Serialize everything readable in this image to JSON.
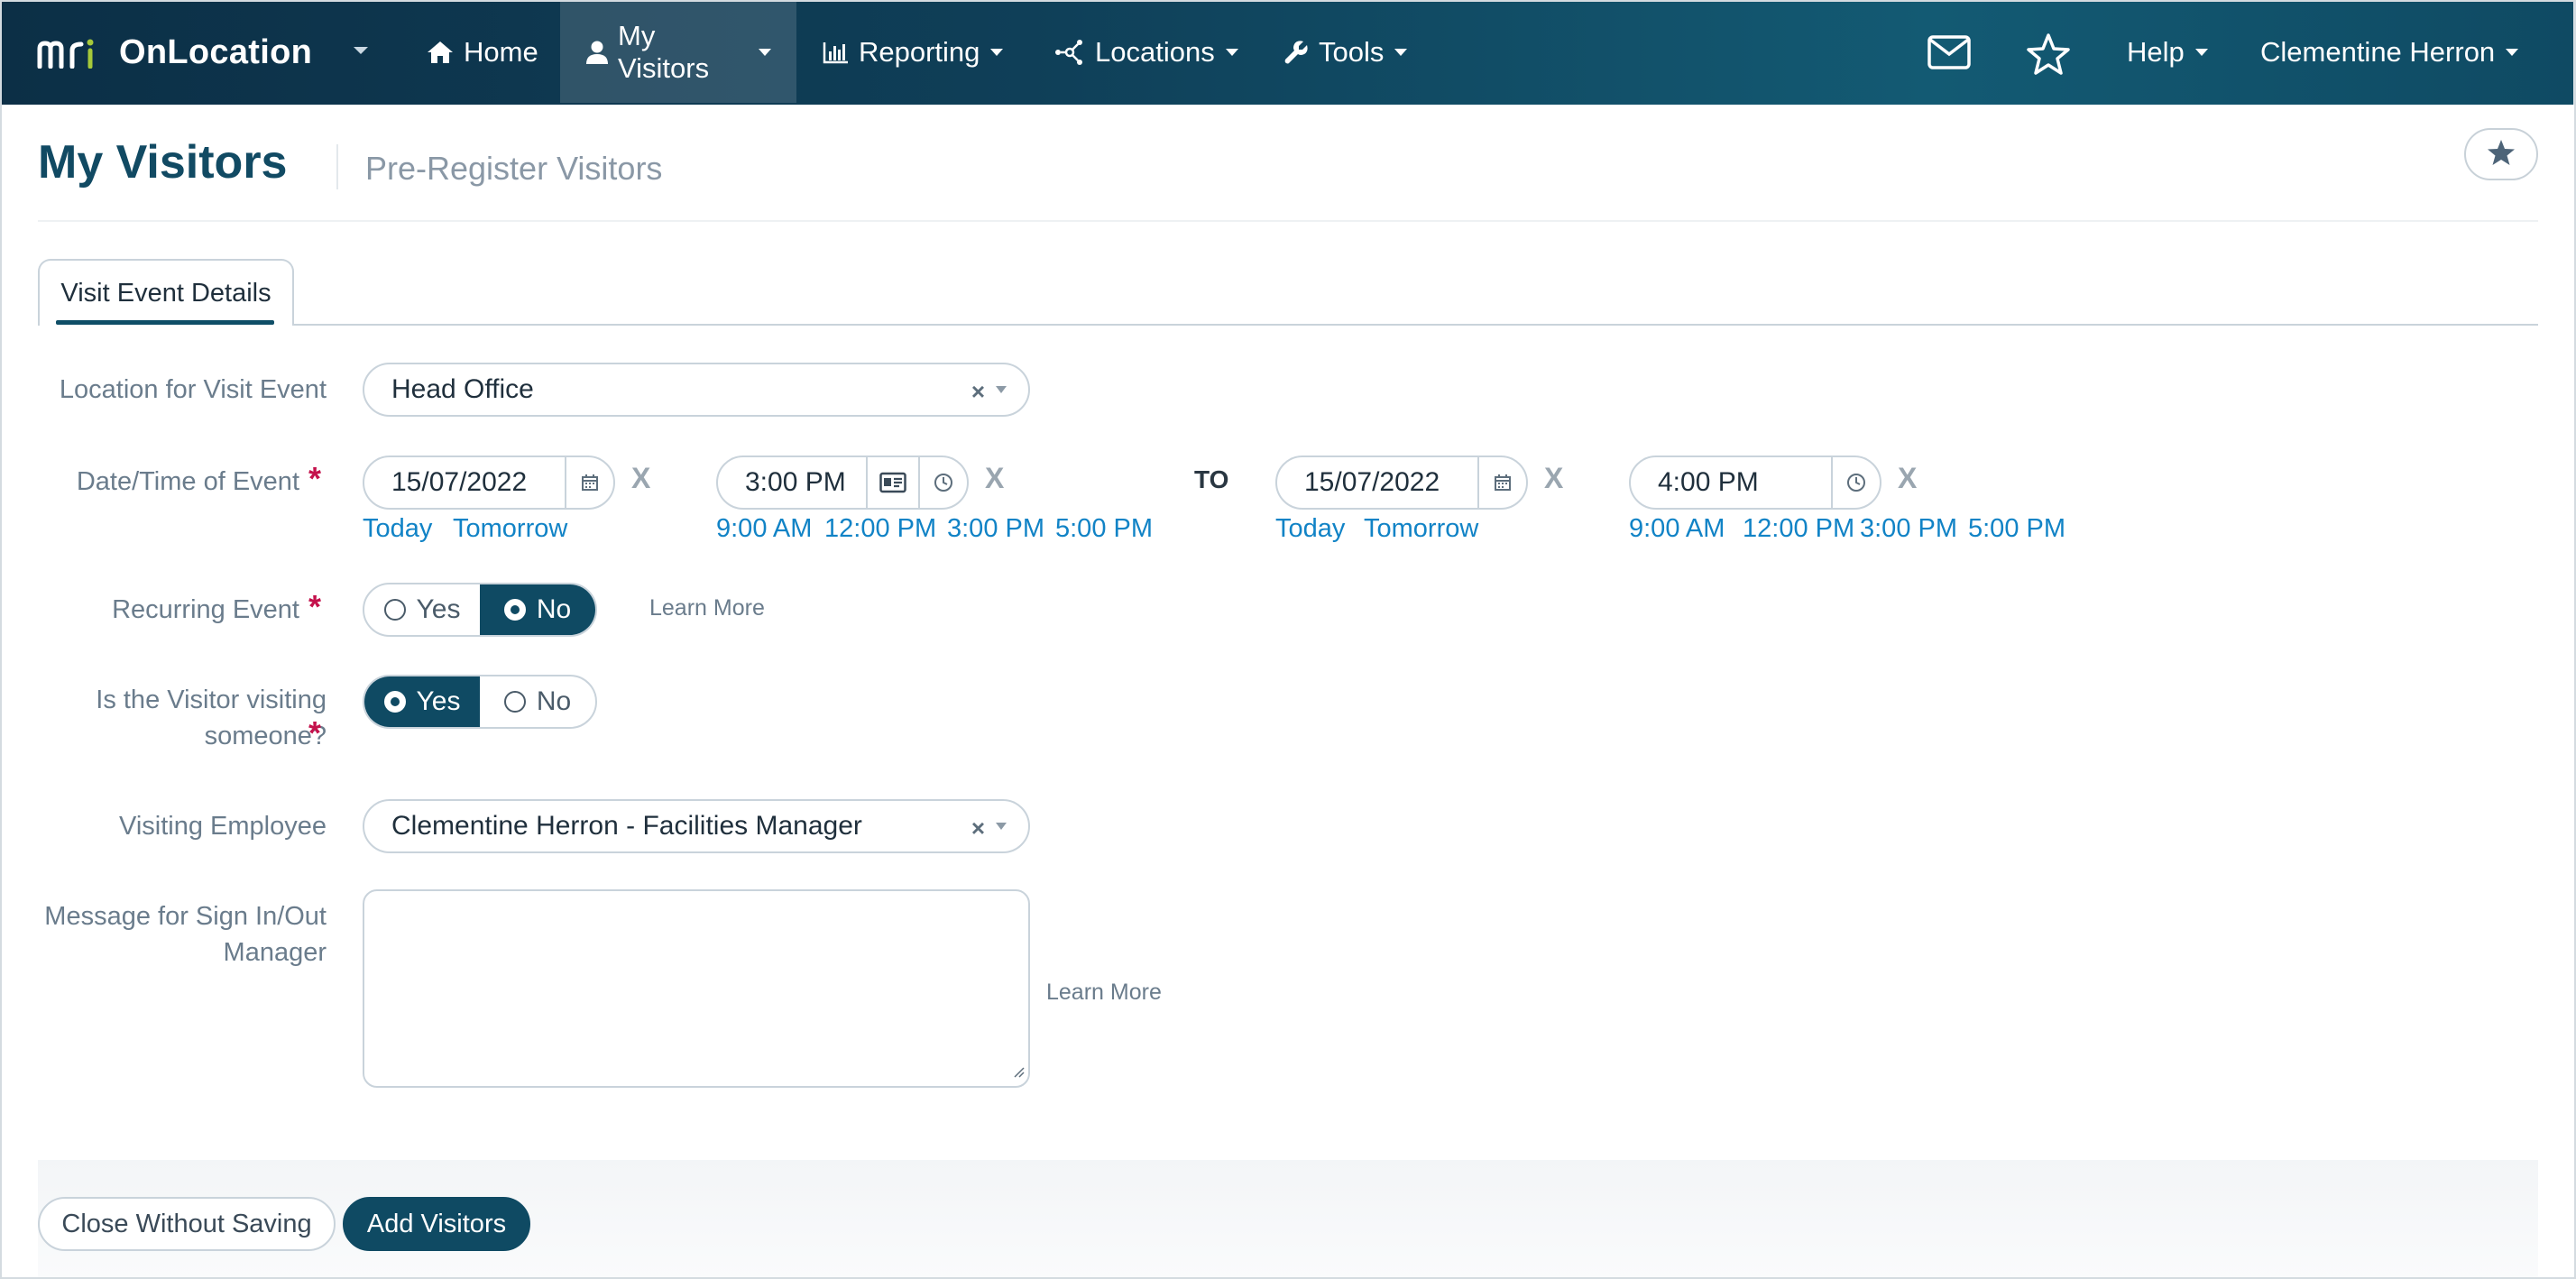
{
  "nav": {
    "brand": "OnLocation",
    "items": [
      {
        "label": "Home",
        "icon": "home-icon"
      },
      {
        "label": "My Visitors",
        "icon": "user-icon"
      },
      {
        "label": "Reporting",
        "icon": "bar-chart-icon"
      },
      {
        "label": "Locations",
        "icon": "network-icon"
      },
      {
        "label": "Tools",
        "icon": "wrench-icon"
      }
    ],
    "help": "Help",
    "user": "Clementine Herron"
  },
  "page": {
    "title": "My Visitors",
    "subtitle": "Pre-Register Visitors"
  },
  "tabs": [
    {
      "label": "Visit Event Details",
      "active": true
    }
  ],
  "form": {
    "location": {
      "label": "Location for Visit Event",
      "value": "Head Office"
    },
    "datetime": {
      "label": "Date/Time of Event",
      "start_date": "15/07/2022",
      "start_time": "3:00 PM",
      "end_date": "15/07/2022",
      "end_time": "4:00 PM",
      "to": "TO",
      "clear": "X",
      "date_shortcuts": [
        "Today",
        "Tomorrow"
      ],
      "time_shortcuts": [
        "9:00 AM",
        "12:00 PM",
        "3:00 PM",
        "5:00 PM"
      ]
    },
    "recurring": {
      "label": "Recurring Event",
      "options": [
        "Yes",
        "No"
      ],
      "selected": "No",
      "learn_more": "Learn More"
    },
    "visiting": {
      "label": "Is the Visitor visiting someone?",
      "options": [
        "Yes",
        "No"
      ],
      "selected": "Yes"
    },
    "employee": {
      "label": "Visiting Employee",
      "value": "Clementine Herron - Facilities Manager"
    },
    "message": {
      "label": "Message for Sign In/Out Manager",
      "value": "",
      "learn_more": "Learn More"
    }
  },
  "footer": {
    "close_label": "Close Without Saving",
    "add_label": "Add Visitors"
  },
  "colors": {
    "primary": "#0f4a63",
    "link": "#1183c6",
    "required": "#c4124c",
    "logo_accent": "#a6c93a"
  }
}
